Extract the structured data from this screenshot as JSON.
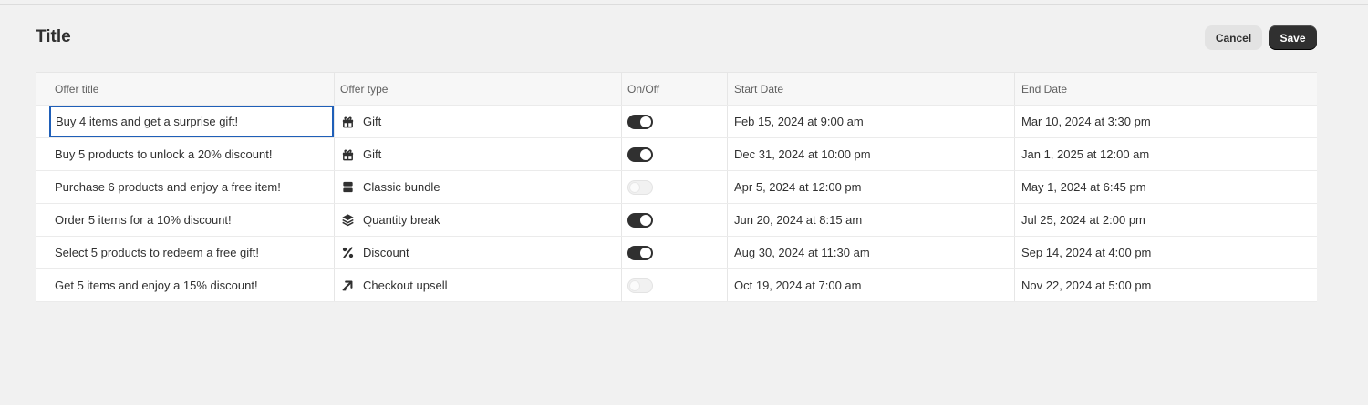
{
  "page": {
    "title": "Title"
  },
  "actions": {
    "cancel_label": "Cancel",
    "save_label": "Save"
  },
  "table": {
    "columns": [
      "Offer title",
      "Offer type",
      "On/Off",
      "Start Date",
      "End Date"
    ],
    "rows": [
      {
        "title": "Buy 4 items and get a surprise gift!",
        "type": "Gift",
        "type_icon": "gift-icon",
        "enabled": true,
        "start": "Feb 15, 2024 at 9:00 am",
        "end": "Mar 10, 2024 at 3:30 pm"
      },
      {
        "title": "Buy 5 products to unlock a 20% discount!",
        "type": "Gift",
        "type_icon": "gift-icon",
        "enabled": true,
        "start": "Dec 31, 2024 at 10:00 pm",
        "end": "Jan 1, 2025 at 12:00 am"
      },
      {
        "title": "Purchase 6 products and enjoy a free item!",
        "type": "Classic bundle",
        "type_icon": "bundle-icon",
        "enabled": false,
        "start": "Apr 5, 2024 at 12:00 pm",
        "end": "May 1, 2024 at 6:45 pm"
      },
      {
        "title": "Order 5 items for a 10% discount!",
        "type": "Quantity break",
        "type_icon": "layers-icon",
        "enabled": true,
        "start": "Jun 20, 2024 at 8:15 am",
        "end": "Jul 25, 2024 at 2:00 pm"
      },
      {
        "title": "Select 5 products to redeem a free gift!",
        "type": "Discount",
        "type_icon": "percent-icon",
        "enabled": true,
        "start": "Aug 30, 2024 at 11:30 am",
        "end": "Sep 14, 2024 at 4:00 pm"
      },
      {
        "title": "Get 5 items and enjoy a 15% discount!",
        "type": "Checkout upsell",
        "type_icon": "arrow-up-right-icon",
        "enabled": false,
        "start": "Oct 19, 2024 at 7:00 am",
        "end": "Nov 22, 2024 at 5:00 pm"
      }
    ]
  },
  "colors": {
    "accent": "#303030",
    "focus": "#1f5fb8",
    "background": "#f1f1f1"
  }
}
